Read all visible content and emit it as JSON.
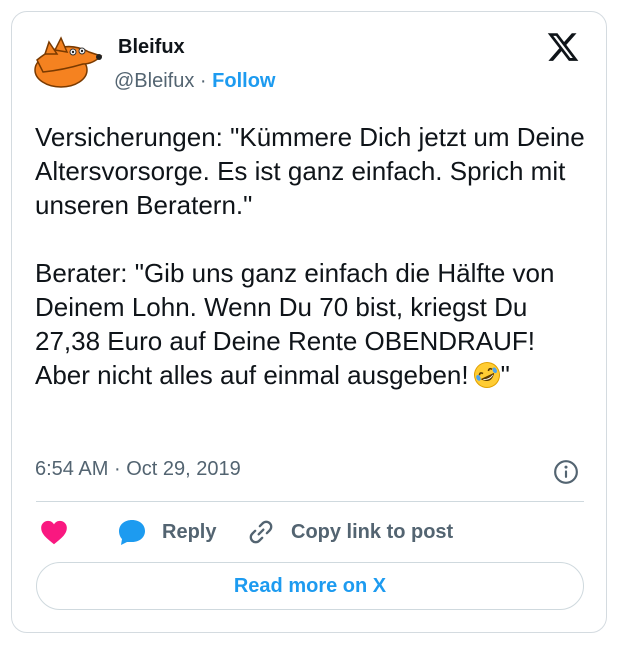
{
  "author": {
    "name": "Bleifux",
    "handle": "@Bleifux",
    "separator": "·",
    "follow_label": "Follow",
    "avatar_icon": "fox-avatar-icon"
  },
  "platform_logo": "x-logo-icon",
  "tweet": {
    "paragraph_1": "Versicherungen: \"Kümmere Dich jetzt um Deine Altersvorsorge. Es ist ganz einfach. Sprich mit unseren Beratern.\"",
    "paragraph_2_text": "Berater: \"Gib uns ganz einfach die Hälfte von Deinem Lohn. Wenn Du 70 bist, kriegst Du 27,38 Euro auf Deine Rente OBENDRAUF! Aber nicht alles auf einmal ausgeben!",
    "paragraph_2_emoji": "rolling-on-floor-laughing-emoji",
    "paragraph_2_end": "\""
  },
  "meta": {
    "time": "6:54 AM",
    "separator": "·",
    "date": "Oct 29, 2019"
  },
  "actions": {
    "like_icon": "heart-icon",
    "reply_label": "Reply",
    "copy_label": "Copy link to post"
  },
  "read_more_label": "Read more on X",
  "colors": {
    "accent": "#1d9bf0",
    "like": "#f91880",
    "text": "#0f1419",
    "muted": "#536471",
    "border": "#cfd9de",
    "avatar_orange": "#f58220"
  }
}
